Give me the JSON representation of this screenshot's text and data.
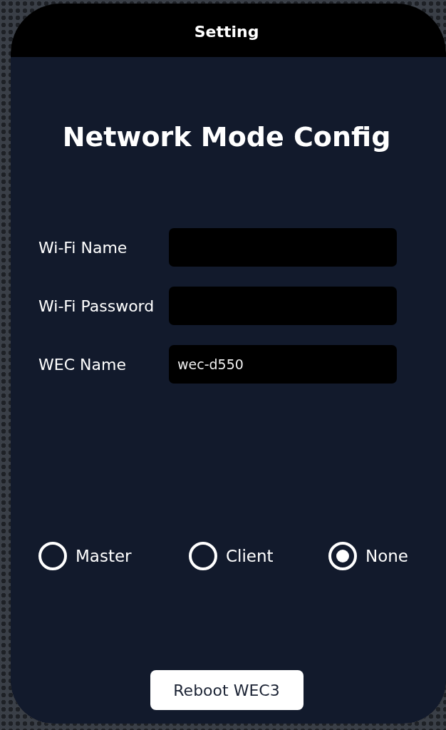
{
  "window": {
    "title": "Setting"
  },
  "heading": "Network Mode Config",
  "fields": [
    {
      "label": "Wi-Fi Name"
    },
    {
      "label": "Wi-Fi Password"
    },
    {
      "label": "WEC Name",
      "value": "wec-d550"
    }
  ],
  "modes": [
    {
      "label": "Master",
      "selected": false
    },
    {
      "label": "Client",
      "selected": false
    },
    {
      "label": "None",
      "selected": true
    }
  ],
  "buttons": [
    "Reboot WEC3"
  ]
}
